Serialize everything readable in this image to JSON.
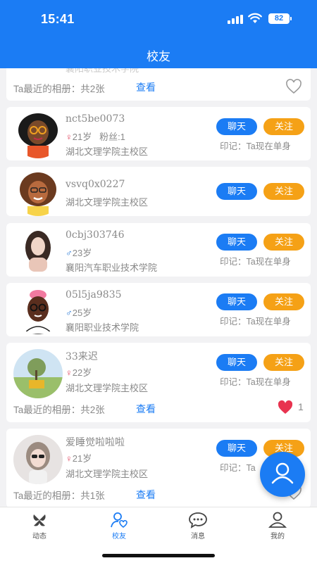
{
  "status_bar": {
    "time": "15:41",
    "battery": "82"
  },
  "header": {
    "title": "校友"
  },
  "partial_card": {
    "school": "襄阳职业技术学院",
    "album_label": "Ta最近的相册：",
    "album_count": "共2张",
    "album_link": "查看"
  },
  "users": [
    {
      "name": "nct5be0073",
      "gender": "♀",
      "age": "21岁",
      "fans": "粉丝:1",
      "school": "湖北文理学院主校区",
      "chat": "聊天",
      "follow": "关注",
      "status": "印记：Ta现在单身"
    },
    {
      "name": "vsvq0x0227",
      "school": "湖北文理学院主校区",
      "chat": "聊天",
      "follow": "关注"
    },
    {
      "name": "0cbj303746",
      "gender": "♂",
      "age": "23岁",
      "school": "襄阳汽车职业技术学院",
      "chat": "聊天",
      "follow": "关注",
      "status": "印记：Ta现在单身"
    },
    {
      "name": "05l5ja9835",
      "gender": "♂",
      "age": "25岁",
      "school": "襄阳职业技术学院",
      "chat": "聊天",
      "follow": "关注",
      "status": "印记：Ta现在单身"
    },
    {
      "name": "33来迟",
      "gender": "♀",
      "age": "22岁",
      "school": "湖北文理学院主校区",
      "chat": "聊天",
      "follow": "关注",
      "status": "印记：Ta现在单身",
      "album_label": "Ta最近的相册：",
      "album_count": "共2张",
      "album_link": "查看",
      "likes": "1"
    },
    {
      "name": "爱睡觉啦啦啦",
      "gender": "♀",
      "age": "21岁",
      "school": "湖北文理学院主校区",
      "chat": "聊天",
      "follow": "关注",
      "status": "印记：Ta",
      "album_label": "Ta最近的相册：",
      "album_count": "共1张",
      "album_link": "查看"
    }
  ],
  "tabs": [
    {
      "label": "动态"
    },
    {
      "label": "校友"
    },
    {
      "label": "消息"
    },
    {
      "label": "我的"
    }
  ],
  "colors": {
    "primary": "#1b7cf4",
    "follow": "#f5a116",
    "female": "#e04a63",
    "male": "#2a7ad6",
    "heart_liked": "#e8334f"
  }
}
